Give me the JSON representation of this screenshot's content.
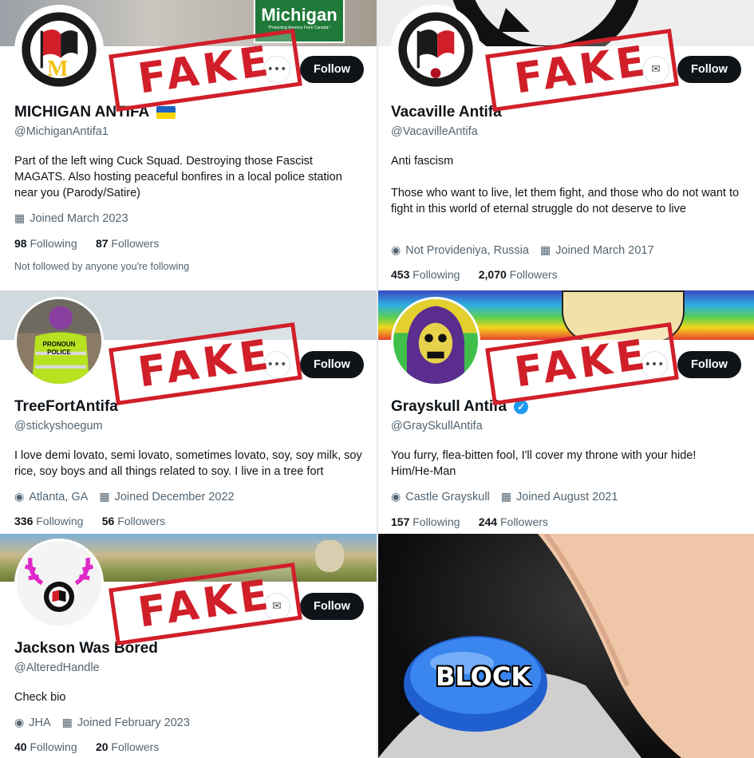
{
  "follow_label": "Follow",
  "fake_label": "FAKE",
  "accent": "#d11f2a",
  "profiles": [
    {
      "name": "MICHIGAN ANTIFA",
      "handle": "@MichiganAntifa1",
      "bio": "Part of the left wing Cuck Squad. Destroying those Fascist MAGATS. Also hosting peaceful bonfires in a local police station near you (Parody/Satire)",
      "joined": "Joined March 2023",
      "following_count": "98",
      "following_label": "Following",
      "followers_count": "87",
      "followers_label": "Followers",
      "note": "Not followed by anyone you're following",
      "banner_sign": "Michigan",
      "banner_sign_sub": "\"Protecting America From Canada.\"",
      "flag": "Ukraine flag",
      "avatar_letter": "M"
    },
    {
      "name": "Vacaville Antifa",
      "handle": "@VacavilleAntifa",
      "bio": "Anti fascism\n\nThose who want to live, let them fight, and those who do not want to fight in this world of eternal struggle do not deserve to live",
      "location": "Not Provideniya, Russia",
      "joined": "Joined March 2017",
      "following_count": "453",
      "following_label": "Following",
      "followers_count": "2,070",
      "followers_label": "Followers"
    },
    {
      "name": "TreeFortAntifa",
      "handle": "@stickyshoegum",
      "bio": "I love demi lovato, semi lovato, sometimes lovato, soy, soy milk, soy rice, soy boys and all things related to soy. I live in a tree fort",
      "location": "Atlanta, GA",
      "joined": "Joined December 2022",
      "following_count": "336",
      "following_label": "Following",
      "followers_count": "56",
      "followers_label": "Followers",
      "vest_text": "PRONOUN POLICE"
    },
    {
      "name": "Grayskull Antifa",
      "handle": "@GraySkullAntifa",
      "bio": "You furry, flea-bitten fool, I'll cover my throne with your hide!\nHim/He-Man",
      "location": "Castle Grayskull",
      "joined": "Joined August 2021",
      "following_count": "157",
      "following_label": "Following",
      "followers_count": "244",
      "followers_label": "Followers"
    },
    {
      "name": "Jackson Was Bored",
      "handle": "@AlteredHandle",
      "bio": "Check bio",
      "location": "JHA",
      "joined": "Joined February 2023",
      "following_count": "40",
      "following_label": "Following",
      "followers_count": "20",
      "followers_label": "Followers"
    }
  ],
  "meme": {
    "button_text": "BLOCK"
  }
}
